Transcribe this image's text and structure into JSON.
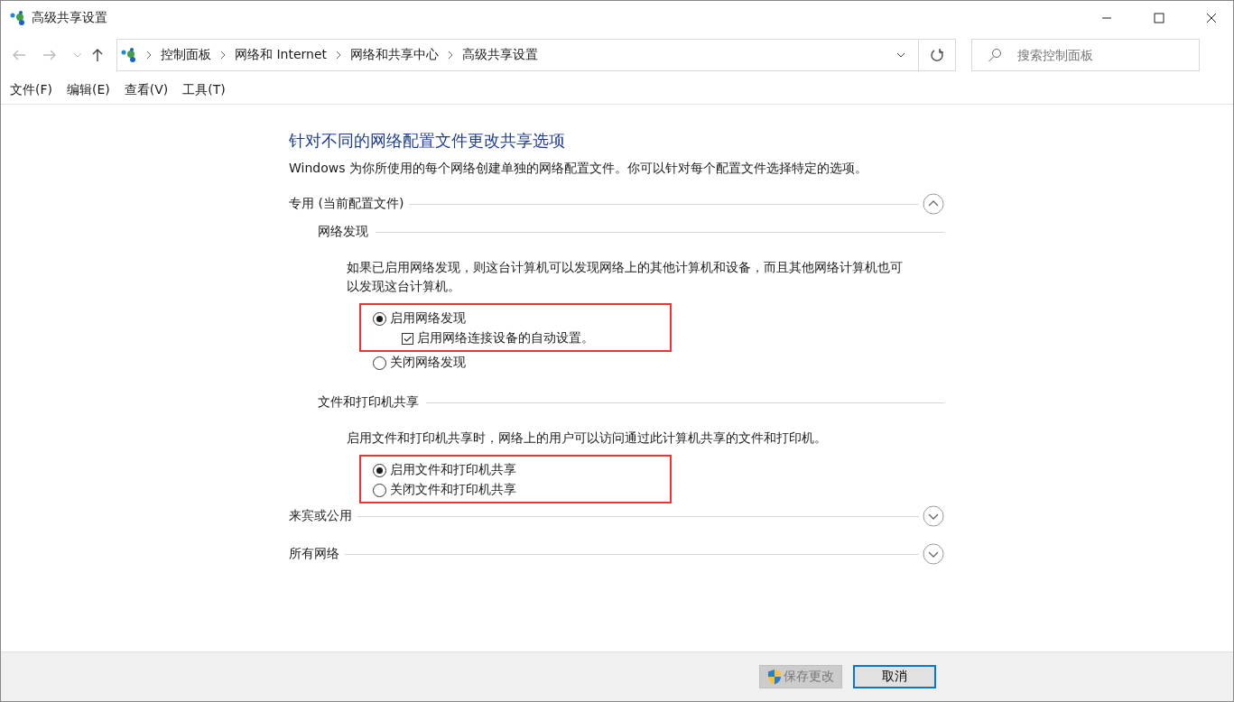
{
  "window": {
    "title": "高级共享设置"
  },
  "breadcrumb": [
    "控制面板",
    "网络和 Internet",
    "网络和共享中心",
    "高级共享设置"
  ],
  "search": {
    "placeholder": "搜索控制面板"
  },
  "menu": [
    "文件(F)",
    "编辑(E)",
    "查看(V)",
    "工具(T)"
  ],
  "heading": "针对不同的网络配置文件更改共享选项",
  "intro": "Windows 为你所使用的每个网络创建单独的网络配置文件。你可以针对每个配置文件选择特定的选项。",
  "profiles": [
    {
      "label": "专用 (当前配置文件)",
      "expanded": true,
      "subsections": [
        {
          "title": "网络发现",
          "description": "如果已启用网络发现，则这台计算机可以发现网络上的其他计算机和设备，而且其他网络计算机也可以发现这台计算机。",
          "option_groups": [
            {
              "highlighted": true,
              "options": [
                {
                  "kind": "radio",
                  "label": "启用网络发现",
                  "selected": true
                },
                {
                  "kind": "checkbox",
                  "label": "启用网络连接设备的自动设置。",
                  "checked": true
                }
              ]
            },
            {
              "highlighted": false,
              "options": [
                {
                  "kind": "radio",
                  "label": "关闭网络发现",
                  "selected": false
                }
              ]
            }
          ]
        },
        {
          "title": "文件和打印机共享",
          "description": "启用文件和打印机共享时，网络上的用户可以访问通过此计算机共享的文件和打印机。",
          "option_groups": [
            {
              "highlighted": true,
              "options": [
                {
                  "kind": "radio",
                  "label": "启用文件和打印机共享",
                  "selected": true
                },
                {
                  "kind": "radio",
                  "label": "关闭文件和打印机共享",
                  "selected": false
                }
              ]
            }
          ]
        }
      ]
    },
    {
      "label": "来宾或公用",
      "expanded": false
    },
    {
      "label": "所有网络",
      "expanded": false
    }
  ],
  "buttons": [
    {
      "label": "保存更改",
      "kind": "shield",
      "disabled": true
    },
    {
      "label": "取消",
      "kind": "plain",
      "disabled": false
    }
  ]
}
